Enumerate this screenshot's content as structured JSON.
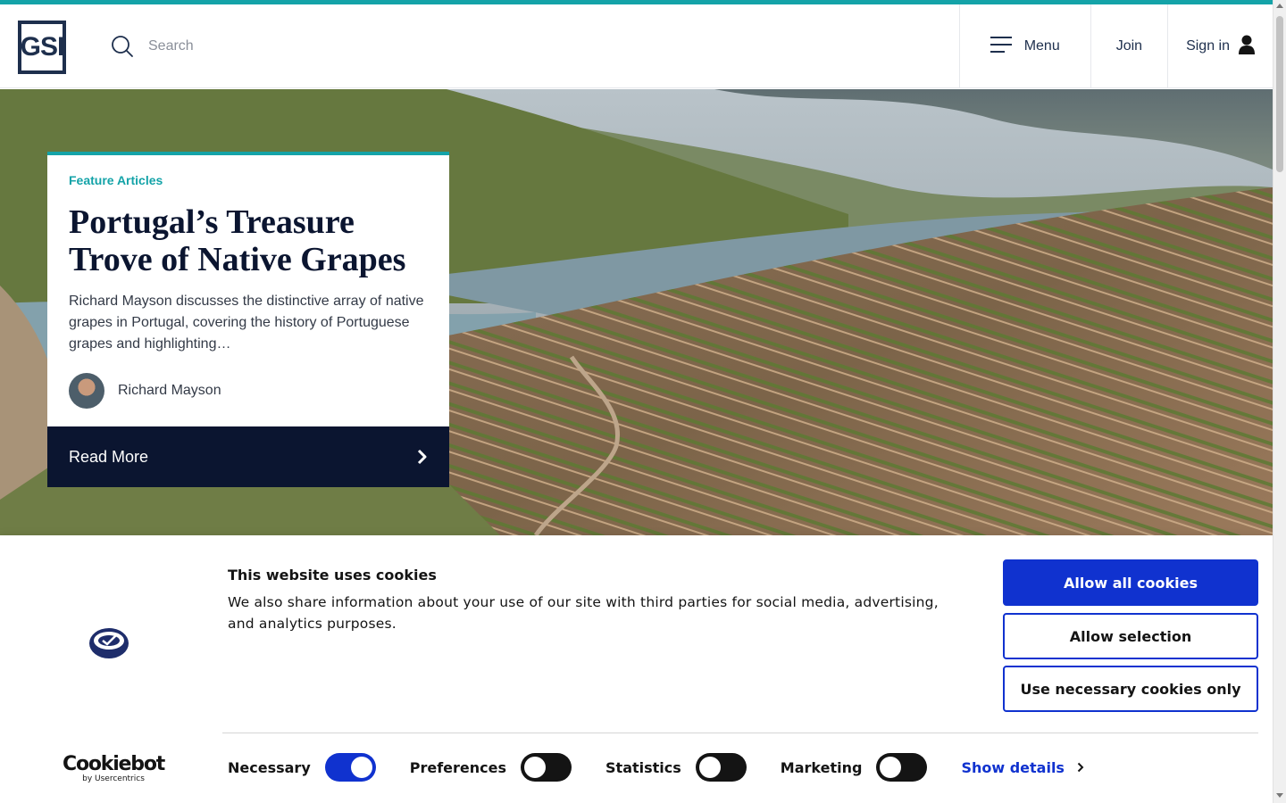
{
  "header": {
    "logo_text": "GSI",
    "search_placeholder": "Search",
    "menu_label": "Menu",
    "join_label": "Join",
    "signin_label": "Sign in"
  },
  "hero": {
    "kicker": "Feature Articles",
    "title": "Portugal’s Treasure Trove of Native Grapes",
    "description": "Richard Mayson discusses the distinctive array of native grapes in Portugal, covering the history of Portuguese grapes and highlighting…",
    "author": "Richard Mayson",
    "read_more": "Read More"
  },
  "cookie_banner": {
    "title": "This website uses cookies",
    "text": "We also share information about your use of our site with third parties for social media, advertising, and analytics purposes.",
    "brand": "Cookiebot",
    "brand_sub": "by Usercentrics",
    "allow_all": "Allow all cookies",
    "allow_selection": "Allow selection",
    "necessary_only": "Use necessary cookies only",
    "toggles": [
      {
        "label": "Necessary",
        "checked": true
      },
      {
        "label": "Preferences",
        "checked": false
      },
      {
        "label": "Statistics",
        "checked": false
      },
      {
        "label": "Marketing",
        "checked": false
      }
    ],
    "show_details": "Show details"
  },
  "colors": {
    "accent": "#14a3a8",
    "navy": "#0b1530",
    "cookiebot_blue": "#1032cf"
  }
}
